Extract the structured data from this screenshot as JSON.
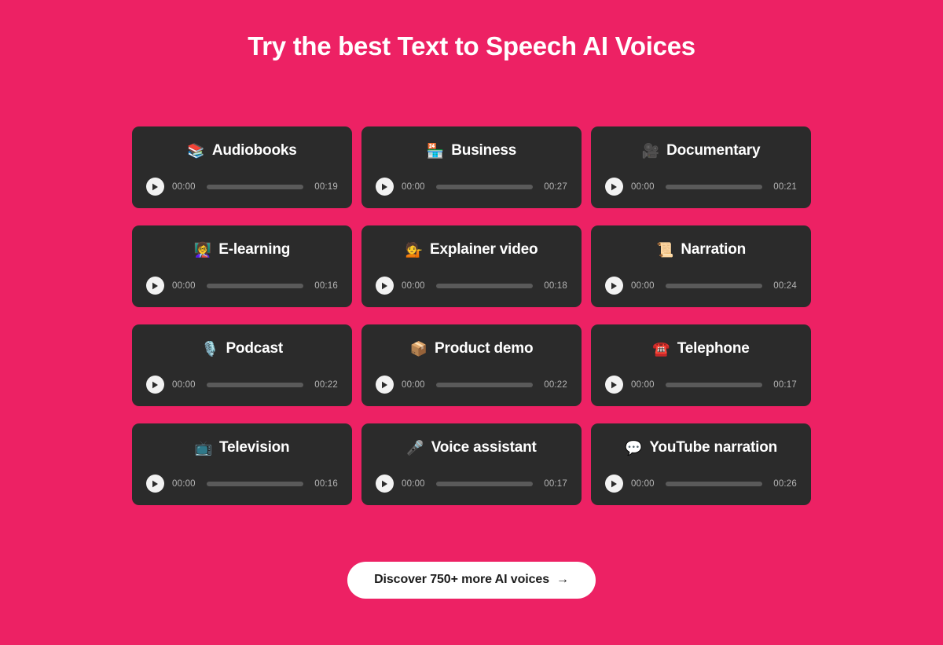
{
  "colors": {
    "background": "#ed2164",
    "card_background": "#2b2b2b",
    "card_title": "#ffffff",
    "time_text": "#b4b4b4",
    "progress_track": "#5a5a5a",
    "play_button": "#f2f2f2",
    "cta_background": "#ffffff",
    "cta_text": "#1c1c1c"
  },
  "header": {
    "title": "Try the best Text to Speech AI Voices"
  },
  "cards": [
    {
      "label": "Audiobooks",
      "emoji": "📚",
      "emoji_name": "books-icon",
      "current_time": "00:00",
      "duration": "00:19",
      "progress_percent": 0
    },
    {
      "label": "Business",
      "emoji": "🏪",
      "emoji_name": "store-icon",
      "current_time": "00:00",
      "duration": "00:27",
      "progress_percent": 0
    },
    {
      "label": "Documentary",
      "emoji": "🎥",
      "emoji_name": "movie-camera-icon",
      "current_time": "00:00",
      "duration": "00:21",
      "progress_percent": 0
    },
    {
      "label": "E-learning",
      "emoji": "👩‍🏫",
      "emoji_name": "teacher-icon",
      "current_time": "00:00",
      "duration": "00:16",
      "progress_percent": 0
    },
    {
      "label": "Explainer video",
      "emoji": "💁",
      "emoji_name": "person-tipping-hand-icon",
      "current_time": "00:00",
      "duration": "00:18",
      "progress_percent": 0
    },
    {
      "label": "Narration",
      "emoji": "📜",
      "emoji_name": "scroll-icon",
      "current_time": "00:00",
      "duration": "00:24",
      "progress_percent": 0
    },
    {
      "label": "Podcast",
      "emoji": "🎙️",
      "emoji_name": "studio-microphone-icon",
      "current_time": "00:00",
      "duration": "00:22",
      "progress_percent": 0
    },
    {
      "label": "Product demo",
      "emoji": "📦",
      "emoji_name": "package-icon",
      "current_time": "00:00",
      "duration": "00:22",
      "progress_percent": 0
    },
    {
      "label": "Telephone",
      "emoji": "☎️",
      "emoji_name": "telephone-icon",
      "current_time": "00:00",
      "duration": "00:17",
      "progress_percent": 0
    },
    {
      "label": "Television",
      "emoji": "📺",
      "emoji_name": "television-icon",
      "current_time": "00:00",
      "duration": "00:16",
      "progress_percent": 0
    },
    {
      "label": "Voice assistant",
      "emoji": "🎤",
      "emoji_name": "microphone-icon",
      "current_time": "00:00",
      "duration": "00:17",
      "progress_percent": 0
    },
    {
      "label": "YouTube narration",
      "emoji": "💬",
      "emoji_name": "speech-balloon-icon",
      "current_time": "00:00",
      "duration": "00:26",
      "progress_percent": 0
    }
  ],
  "cta": {
    "label": "Discover 750+ more AI voices",
    "arrow": "→"
  }
}
